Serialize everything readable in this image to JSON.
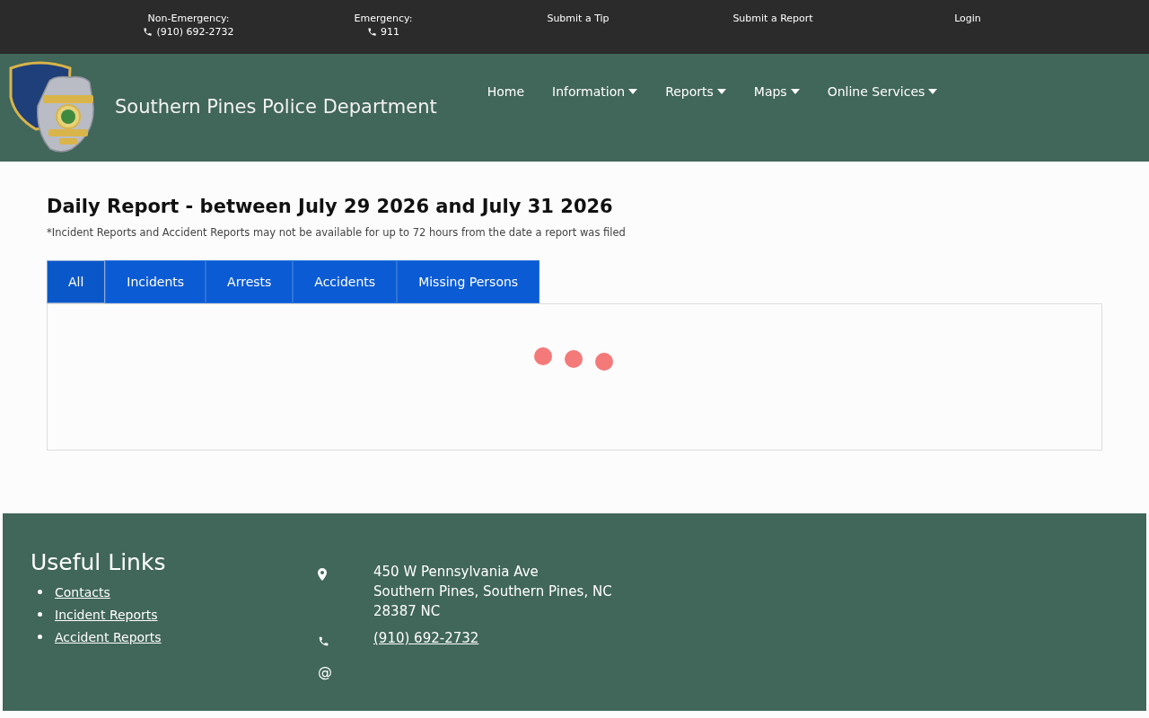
{
  "top_bar": [
    {
      "kind": "phone",
      "label": "Non-Emergency:",
      "value": "(910) 692-2732"
    },
    {
      "kind": "phone",
      "label": "Emergency:",
      "value": "911"
    },
    {
      "kind": "link",
      "label": "Submit a Tip"
    },
    {
      "kind": "link",
      "label": "Submit a Report"
    },
    {
      "kind": "link",
      "label": "Login"
    }
  ],
  "header": {
    "title": "Southern Pines Police Department",
    "nav": [
      {
        "label": "Home",
        "dropdown": false
      },
      {
        "label": "Information",
        "dropdown": true
      },
      {
        "label": "Reports",
        "dropdown": true
      },
      {
        "label": "Maps",
        "dropdown": true
      },
      {
        "label": "Online Services",
        "dropdown": true
      }
    ]
  },
  "report": {
    "heading": "Daily Report - between July 29 2026 and July 31 2026",
    "note": "*Incident Reports and Accident Reports may not be available for up to 72 hours from the date a report was filed",
    "tabs": [
      {
        "label": "All",
        "selected": true
      },
      {
        "label": "Incidents",
        "selected": false
      },
      {
        "label": "Arrests",
        "selected": false
      },
      {
        "label": "Accidents",
        "selected": false
      },
      {
        "label": "Missing Persons",
        "selected": false
      }
    ],
    "loading": true
  },
  "footer": {
    "title": "Useful Links",
    "links": [
      "Contacts",
      "Incident Reports",
      "Accident Reports"
    ],
    "contacts": [
      {
        "kind": "address",
        "lines": [
          "450 W Pennsylvania Ave",
          "Southern Pines, Southern Pines, NC",
          "28387 NC"
        ]
      },
      {
        "kind": "phone",
        "link": "(910) 692-2732"
      },
      {
        "kind": "email",
        "symbol": "@"
      }
    ]
  }
}
